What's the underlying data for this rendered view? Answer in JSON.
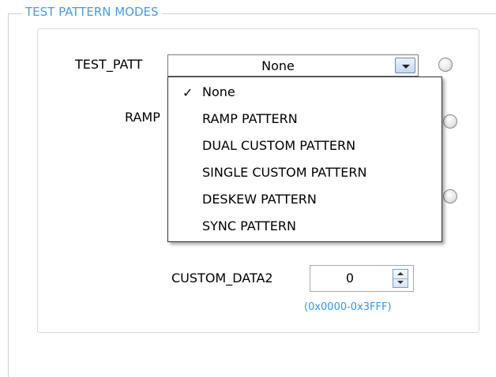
{
  "group": {
    "title": "TEST PATTERN MODES"
  },
  "test_patt": {
    "label": "TEST_PATT",
    "selected": "None"
  },
  "ramp": {
    "label_partial": "RAMP"
  },
  "dropdown": {
    "check_glyph": "✓",
    "items": [
      {
        "label": "None",
        "checked": true
      },
      {
        "label": "RAMP PATTERN",
        "checked": false
      },
      {
        "label": "DUAL CUSTOM PATTERN",
        "checked": false
      },
      {
        "label": "SINGLE CUSTOM PATTERN",
        "checked": false
      },
      {
        "label": "DESKEW PATTERN",
        "checked": false
      },
      {
        "label": "SYNC PATTERN",
        "checked": false
      }
    ]
  },
  "custom_data2": {
    "label": "CUSTOM_DATA2",
    "value": "0",
    "range_hint": "(0x0000-0x3FFF)"
  },
  "colors": {
    "accent": "#4a9be0",
    "hint": "#3a96dd"
  },
  "icons": {
    "combo_arrow": "chevron-down-icon",
    "spin": "spin-arrows-icon"
  }
}
